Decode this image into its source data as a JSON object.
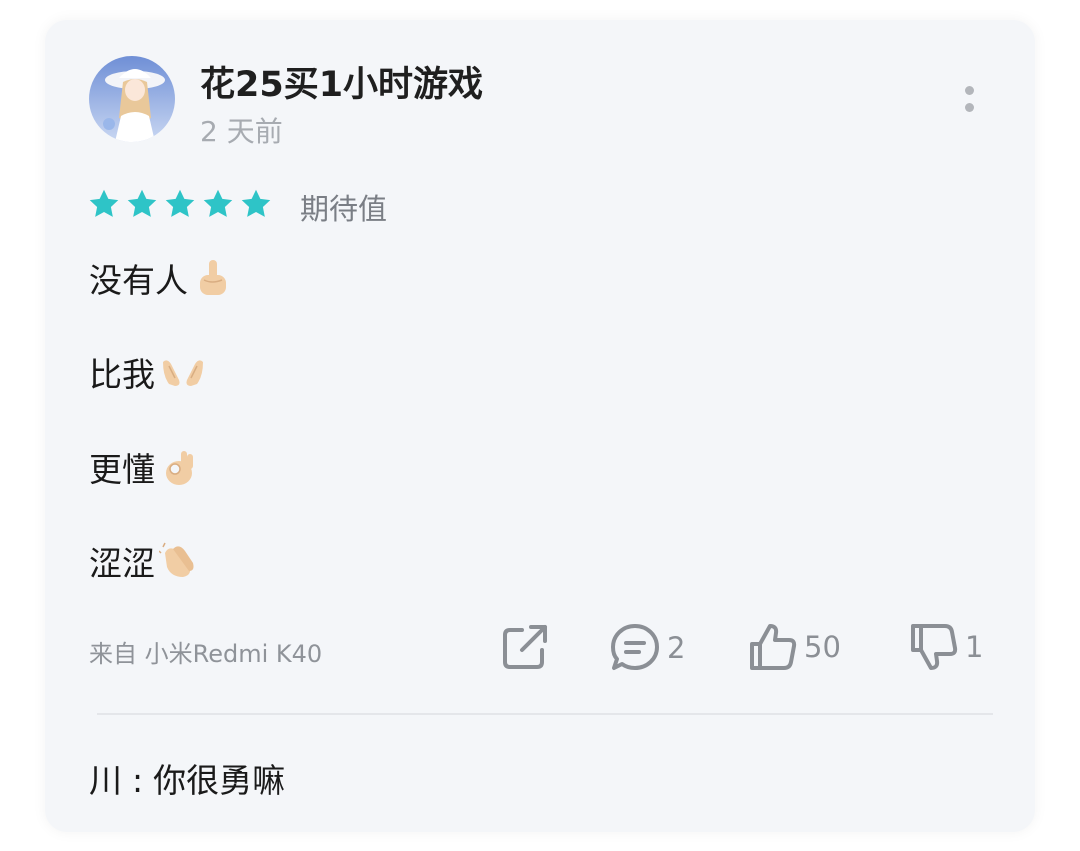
{
  "review": {
    "username": "花25买1小时游戏",
    "time_ago": "2 天前",
    "rating": {
      "stars": 5,
      "max": 5,
      "label": "期待值",
      "star_color": "#2ec4c7"
    },
    "lines": [
      {
        "text": "没有人",
        "emoji": "index-pointing-up-emoji"
      },
      {
        "text": "比我",
        "emoji": "palms-up-together-emoji"
      },
      {
        "text": "更懂",
        "emoji": "ok-hand-emoji"
      },
      {
        "text": "涩涩",
        "emoji": "clapping-hands-emoji"
      }
    ],
    "source": "来自 小米Redmi K40",
    "actions": {
      "share_icon": "share-icon",
      "comment_count": "2",
      "like_count": "50",
      "dislike_count": "1"
    }
  },
  "reply": {
    "author": "川",
    "separator": ":",
    "text": "你很勇嘛"
  }
}
